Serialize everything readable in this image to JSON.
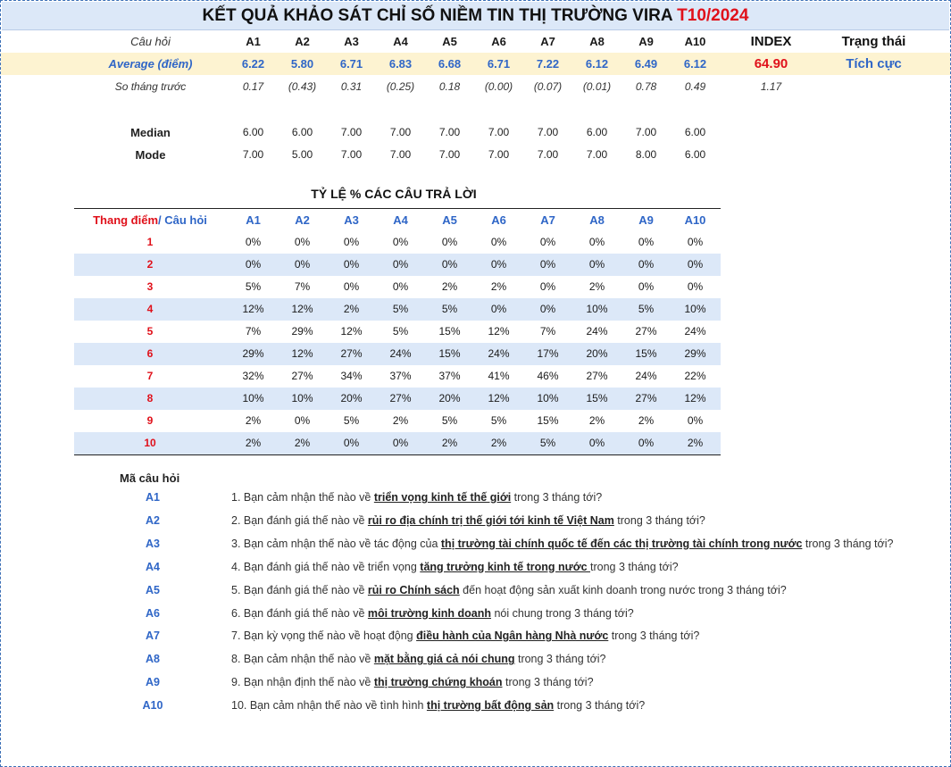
{
  "title": {
    "main": "KẾT QUẢ KHẢO SÁT CHỈ SỐ NIỀM TIN THỊ TRƯỜNG VIRA",
    "period": "T10/2024"
  },
  "summary": {
    "header": {
      "label": "Câu hỏi",
      "questions": [
        "A1",
        "A2",
        "A3",
        "A4",
        "A5",
        "A6",
        "A7",
        "A8",
        "A9",
        "A10"
      ],
      "index": "INDEX",
      "status": "Trạng thái"
    },
    "average": {
      "label": "Average (điểm)",
      "values": [
        "6.22",
        "5.80",
        "6.71",
        "6.83",
        "6.68",
        "6.71",
        "7.22",
        "6.12",
        "6.49",
        "6.12"
      ],
      "index": "64.90",
      "status": "Tích cực"
    },
    "prev_month": {
      "label": "So tháng trước",
      "values": [
        "0.17",
        "(0.43)",
        "0.31",
        "(0.25)",
        "0.18",
        "(0.00)",
        "(0.07)",
        "(0.01)",
        "0.78",
        "0.49"
      ],
      "index": "1.17"
    },
    "median": {
      "label": "Median",
      "values": [
        "6.00",
        "6.00",
        "7.00",
        "7.00",
        "7.00",
        "7.00",
        "7.00",
        "6.00",
        "7.00",
        "6.00"
      ]
    },
    "mode": {
      "label": "Mode",
      "values": [
        "7.00",
        "5.00",
        "7.00",
        "7.00",
        "7.00",
        "7.00",
        "7.00",
        "7.00",
        "8.00",
        "6.00"
      ]
    }
  },
  "distribution": {
    "title": "TỶ LỆ % CÁC CÂU TRẢ LỜI",
    "header_scale": "Thang điểm",
    "header_question": "/ Câu hỏi",
    "questions": [
      "A1",
      "A2",
      "A3",
      "A4",
      "A5",
      "A6",
      "A7",
      "A8",
      "A9",
      "A10"
    ],
    "rows": [
      {
        "scale": "1",
        "values": [
          "0%",
          "0%",
          "0%",
          "0%",
          "0%",
          "0%",
          "0%",
          "0%",
          "0%",
          "0%"
        ]
      },
      {
        "scale": "2",
        "values": [
          "0%",
          "0%",
          "0%",
          "0%",
          "0%",
          "0%",
          "0%",
          "0%",
          "0%",
          "0%"
        ]
      },
      {
        "scale": "3",
        "values": [
          "5%",
          "7%",
          "0%",
          "0%",
          "2%",
          "2%",
          "0%",
          "2%",
          "0%",
          "0%"
        ]
      },
      {
        "scale": "4",
        "values": [
          "12%",
          "12%",
          "2%",
          "5%",
          "5%",
          "0%",
          "0%",
          "10%",
          "5%",
          "10%"
        ]
      },
      {
        "scale": "5",
        "values": [
          "7%",
          "29%",
          "12%",
          "5%",
          "15%",
          "12%",
          "7%",
          "24%",
          "27%",
          "24%"
        ]
      },
      {
        "scale": "6",
        "values": [
          "29%",
          "12%",
          "27%",
          "24%",
          "15%",
          "24%",
          "17%",
          "20%",
          "15%",
          "29%"
        ]
      },
      {
        "scale": "7",
        "values": [
          "32%",
          "27%",
          "34%",
          "37%",
          "37%",
          "41%",
          "46%",
          "27%",
          "24%",
          "22%"
        ]
      },
      {
        "scale": "8",
        "values": [
          "10%",
          "10%",
          "20%",
          "27%",
          "20%",
          "12%",
          "10%",
          "15%",
          "27%",
          "12%"
        ]
      },
      {
        "scale": "9",
        "values": [
          "2%",
          "0%",
          "5%",
          "2%",
          "5%",
          "5%",
          "15%",
          "2%",
          "2%",
          "0%"
        ]
      },
      {
        "scale": "10",
        "values": [
          "2%",
          "2%",
          "0%",
          "0%",
          "2%",
          "2%",
          "5%",
          "0%",
          "0%",
          "2%"
        ]
      }
    ]
  },
  "codes": {
    "title": "Mã câu hỏi",
    "items": [
      {
        "code": "A1",
        "pre": "1. Bạn cảm nhận thế nào về ",
        "key": "triển vọng kinh tế thế giới",
        "post": " trong 3 tháng tới?"
      },
      {
        "code": "A2",
        "pre": "2. Bạn đánh giá thế nào về ",
        "key": "rủi ro địa chính trị thế giới tới kinh tế Việt Nam",
        "post": " trong 3 tháng tới?"
      },
      {
        "code": "A3",
        "pre": "3. Bạn cảm nhận thế nào về tác động của ",
        "key": "thị trường tài chính quốc tế đến các thị trường tài chính trong nước",
        "post": " trong 3 tháng tới?"
      },
      {
        "code": "A4",
        "pre": "4. Bạn đánh giá thế nào về triển vọng ",
        "key": "tăng trưởng kinh tế trong nước ",
        "post": "trong 3 tháng tới?"
      },
      {
        "code": "A5",
        "pre": "5. Bạn đánh giá thế nào về ",
        "key": "rủi ro Chính sách",
        "post": " đến hoạt động sản xuất kinh doanh trong nước trong 3 tháng tới?"
      },
      {
        "code": "A6",
        "pre": "6. Bạn đánh giá thế nào về ",
        "key": "môi trường kinh doanh",
        "post": " nói chung trong 3 tháng tới?"
      },
      {
        "code": "A7",
        "pre": "7. Bạn kỳ vọng thế nào về hoạt động ",
        "key": "điều hành của Ngân hàng Nhà nước",
        "post": " trong 3 tháng tới?"
      },
      {
        "code": "A8",
        "pre": "8. Bạn cảm nhận thế nào về ",
        "key": "mặt bằng giá cả nói chung",
        "post": " trong 3 tháng tới?"
      },
      {
        "code": "A9",
        "pre": "9. Bạn nhận định thế nào về ",
        "key": "thị trường chứng khoán",
        "post": " trong 3 tháng tới?"
      },
      {
        "code": "A10",
        "pre": "10. Bạn cảm nhận thế nào về tình hình ",
        "key": "thị trường bất động sản",
        "post": " trong 3 tháng tới?"
      }
    ]
  }
}
